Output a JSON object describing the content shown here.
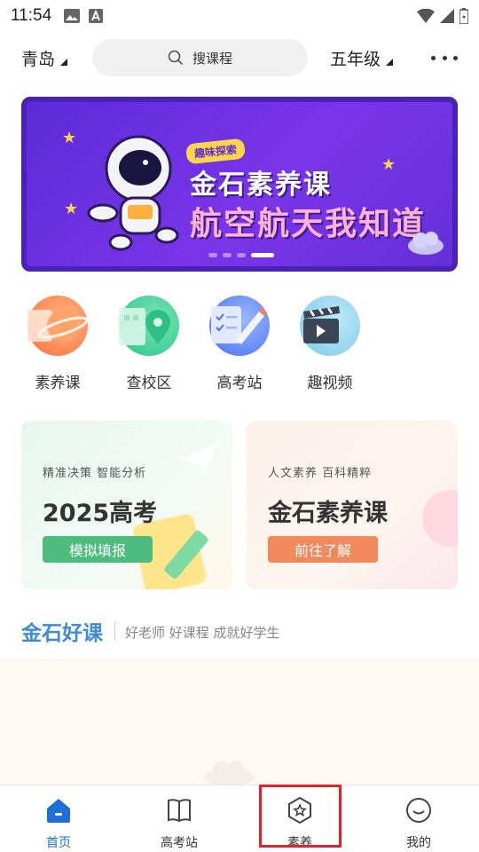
{
  "status_bar": {
    "time": "11:54"
  },
  "top_bar": {
    "city": "青岛",
    "search_placeholder": "搜课程",
    "grade": "五年级"
  },
  "banner": {
    "tag": "趣味探索",
    "title": "金石素养课",
    "subtitle": "航空航天我知道",
    "dot_count": 4,
    "active_dot": 3
  },
  "quick_entries": [
    {
      "label": "素养课",
      "icon": "planet-icon"
    },
    {
      "label": "查校区",
      "icon": "location-building-icon"
    },
    {
      "label": "高考站",
      "icon": "checklist-pencil-icon"
    },
    {
      "label": "趣视频",
      "icon": "clapperboard-icon"
    }
  ],
  "cards": [
    {
      "kicker": "精准决策 智能分析",
      "title": "2025高考",
      "button": "模拟填报"
    },
    {
      "kicker": "人文素养 百科精粹",
      "title": "金石素养课",
      "button": "前往了解"
    }
  ],
  "section": {
    "title": "金石好课",
    "subtitle": "好老师 好课程 成就好学生"
  },
  "tabbar": {
    "tabs": [
      {
        "label": "首页",
        "active": true
      },
      {
        "label": "高考站",
        "active": false
      },
      {
        "label": "素养",
        "active": false
      },
      {
        "label": "我的",
        "active": false
      }
    ]
  },
  "colors": {
    "accent": "#1e70d6",
    "section_title": "#3f8bd8",
    "highlight": "#e3232b"
  }
}
